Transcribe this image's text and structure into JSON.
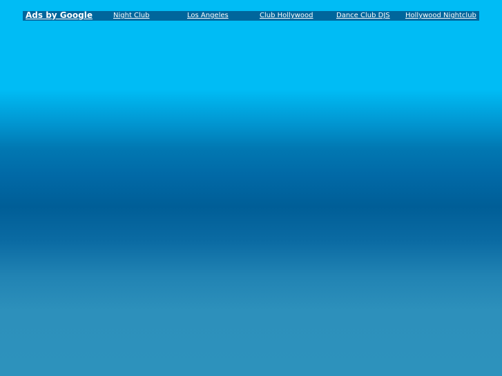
{
  "ads_bar": {
    "title": "Ads by Google",
    "links": [
      {
        "label": "Night Club"
      },
      {
        "label": "Los Angeles"
      },
      {
        "label": "Club Hollywood"
      },
      {
        "label": "Dance Club DJS"
      },
      {
        "label": "Hollywood Nightclub"
      }
    ]
  },
  "colors": {
    "ad_bar_background": "#00669c",
    "page_top": "#00bcf5",
    "page_mid": "#005e97",
    "page_bottom": "#2d92bc",
    "link_text": "#ffffff"
  }
}
